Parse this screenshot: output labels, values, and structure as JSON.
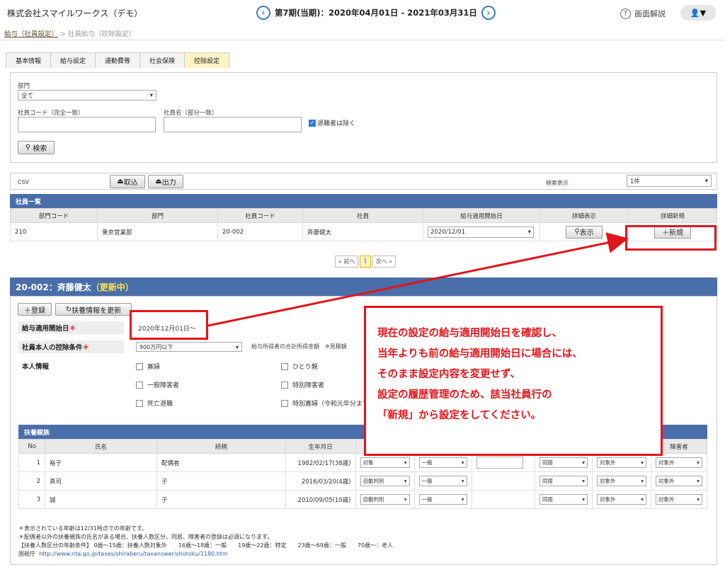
{
  "header": {
    "company": "株式会社スマイルワークス（デモ）",
    "period": "第7期(当期)：2020年04月01日 - 2021年03月31日",
    "help": "画面解説",
    "user_icon": "user-icon"
  },
  "breadcrumb": {
    "parent": "給与（社員設定）",
    "sep": ">",
    "current": "社員給与（控除設定）"
  },
  "tabs": [
    "基本情報",
    "給与設定",
    "通勤費等",
    "社会保険",
    "控除設定"
  ],
  "search": {
    "dept_label": "部門",
    "dept_value": "全て",
    "code_label": "社員コード（完全一致）",
    "name_label": "社員名（部分一致）",
    "exclude_retired": "退職者は除く",
    "search_btn": "検索"
  },
  "csv": {
    "label": "CSV",
    "import": "取込",
    "export": "出力",
    "display_label": "検索表示",
    "display_value": "1件"
  },
  "list": {
    "title": "社員一覧",
    "headers": [
      "部門コード",
      "部門",
      "社員コード",
      "社員",
      "給与適用開始日",
      "詳細表示",
      "詳細新規"
    ],
    "row": {
      "dept_code": "210",
      "dept": "東京営業部",
      "emp_code": "20-002",
      "emp": "斉藤健太",
      "start": "2020/12/01",
      "show": "表示",
      "new": "新規"
    }
  },
  "pager": {
    "prev": "« 前へ",
    "page": "1",
    "next": "次へ »"
  },
  "detail": {
    "title": "20-002：斉藤健太",
    "status": "（更新中）",
    "register": "登録",
    "refresh": "扶養情報を更新",
    "start_label": "給与適用開始日",
    "start_value": "2020年12月01日～",
    "cond_label": "社員本人の控除条件",
    "cond_value": "900万円以下",
    "income_note": "給与所得者の合計所得金額　※見積額",
    "self_label": "本人情報",
    "checks": [
      "寡婦",
      "ひとり親",
      "一般障害者",
      "特別障害者",
      "死亡退職",
      "特別寡婦（令和元年分まで）"
    ]
  },
  "dependents": {
    "title": "扶養親族",
    "headers": [
      "No",
      "氏名",
      "続柄",
      "生年月日",
      "障害者"
    ],
    "rows": [
      {
        "no": "1",
        "name": "裕子",
        "rel": "配偶者",
        "birth": "1982/02/17(38歳)",
        "s1": "対象",
        "s2": "一般",
        "s3": "",
        "live": "同居",
        "s4": "対象外",
        "dis": "対象外"
      },
      {
        "no": "2",
        "name": "真司",
        "rel": "子",
        "birth": "2016/03/20(4歳)",
        "s1": "自動判別",
        "s2": "一般",
        "s3": "",
        "live": "同居",
        "s4": "対象外",
        "dis": "対象外"
      },
      {
        "no": "3",
        "name": "誠",
        "rel": "子",
        "birth": "2010/09/05(10歳)",
        "s1": "自動判別",
        "s2": "一般",
        "s3": "",
        "live": "同居",
        "s4": "対象外",
        "dis": "対象外"
      }
    ]
  },
  "notes": [
    "＊表示されている年齢は12/31時点での年齢です。",
    "＊配偶者以外の扶養親族の氏名がある場合、扶養人数区分、同居、障害者の登録は必須になります。",
    "【扶養人数区分の年齢条件】 0歳～15歳：扶養人数対象外　　16歳～18歳：一般　　19歳～22歳：特定　　23歳～69歳：一般　　70歳～：老人"
  ],
  "nta": {
    "label": "国税庁",
    "url": "http://www.nta.go.jp/taxes/shiraberu/taxanswer/shotoku/1180.htm"
  },
  "callout": [
    "現在の設定の給与適用開始日を確認し、",
    "当年よりも前の給与適用開始日に場合には、",
    "そのまま設定内容を変更せず、",
    "設定の履歴管理のため、該当社員行の",
    "「新規」から設定をしてください。"
  ],
  "colors": {
    "accent": "#e3141b",
    "header": "#4a6ea9"
  }
}
